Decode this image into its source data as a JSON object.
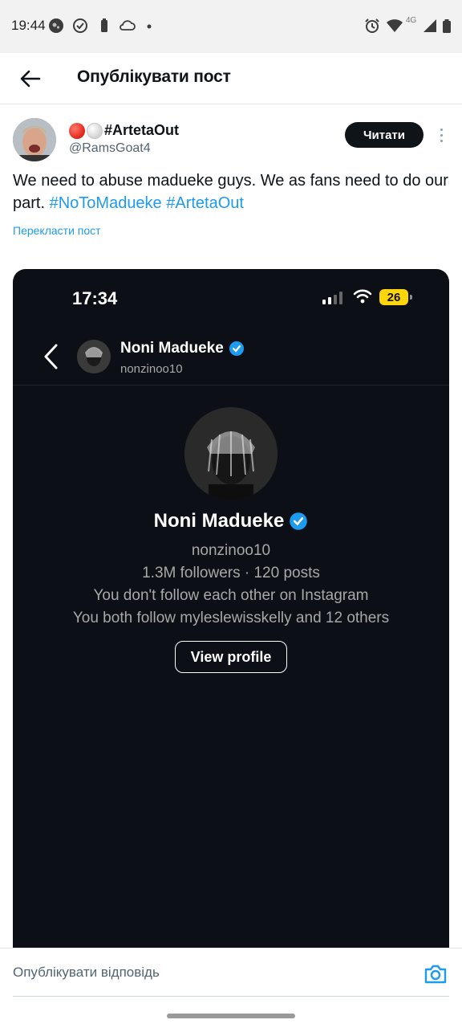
{
  "status_bar": {
    "time": "19:44",
    "network": "4G",
    "left_icons": [
      "app-icon",
      "check-circle-icon",
      "battery-saver-icon",
      "cloud-icon",
      "dot-icon"
    ],
    "right_icons": [
      "alarm-icon",
      "wifi-icon",
      "signal-icon",
      "battery-icon"
    ]
  },
  "header": {
    "title": "Опублікувати пост"
  },
  "post": {
    "author_name": "#ArtetaOut",
    "author_handle": "@RamsGoat4",
    "follow_label": "Читати",
    "text_plain": "We need to abuse madueke guys. We as fans need to do our part.",
    "hashtags": [
      "#NoToMadueke",
      "#ArtetaOut"
    ],
    "translate_label": "Перекласти пост"
  },
  "media": {
    "phone_time": "17:34",
    "battery_level": "26",
    "header_name": "Noni Madueke",
    "header_handle": "nonzinoo10",
    "profile_name": "Noni Madueke",
    "profile_handle": "nonzinoo10",
    "stats": "1.3M followers · 120 posts",
    "follow_status": "You don't follow each other on Instagram",
    "mutual": "You both follow myleslewisskelly and 12 others",
    "view_profile_label": "View profile"
  },
  "reply": {
    "placeholder": "Опублікувати відповідь"
  },
  "colors": {
    "accent": "#1d9bf0",
    "text": "#0f1419",
    "muted": "#536471",
    "media_bg": "#0c0f15",
    "verified": "#1d9bf0",
    "battery": "#ffd60a"
  }
}
